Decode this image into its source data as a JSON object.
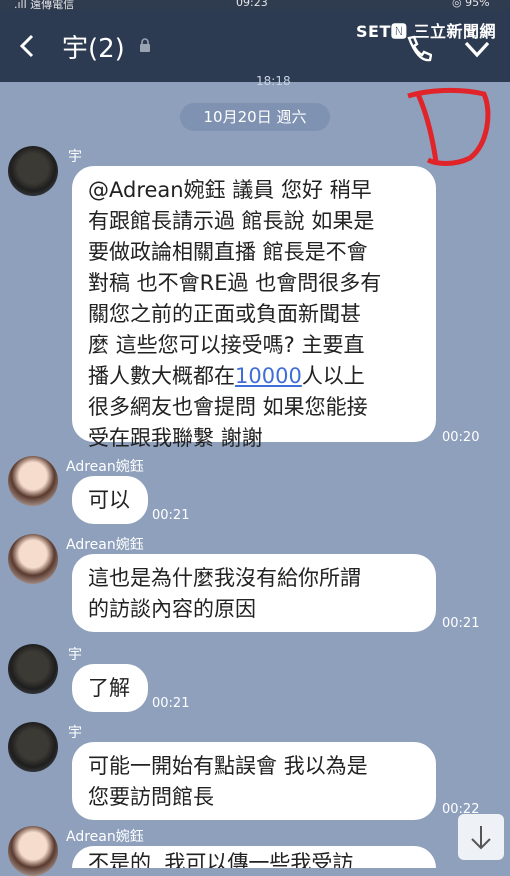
{
  "status": {
    "carrier": ".ıll 遠傳電信",
    "time": "09:23",
    "battery": "◎ 95%"
  },
  "header": {
    "title": "宇(2)",
    "watermark": "SET🅽 三立新聞網"
  },
  "prev_time": "18:18",
  "date_separator": "10月20日 週六",
  "messages": [
    {
      "sender": "宇",
      "pre": "@Adrean婉鈺 議員 您好 稍早\n有跟館長請示過 館長說 如果是\n要做政論相關直播 館長是不會\n對稿 也不會RE過 也會問很多有\n關您之前的正面或負面新聞甚\n麼 這些您可以接受嗎? 主要直\n播人數大概都在",
      "link": "10000",
      "post": "人以上\n很多網友也會提問 如果您能接\n受在跟我聯繫 謝謝",
      "time": "00:20"
    },
    {
      "sender": "Adrean婉鈺",
      "text": "可以",
      "time": "00:21"
    },
    {
      "sender": "Adrean婉鈺",
      "text": "這也是為什麼我沒有給你所謂\n的訪談內容的原因",
      "time": "00:21"
    },
    {
      "sender": "宇",
      "text": "了解",
      "time": "00:21"
    },
    {
      "sender": "宇",
      "text": "可能一開始有點誤會 我以為是\n您要訪問館長",
      "time": "00:22"
    },
    {
      "sender": "Adrean婉鈺",
      "text": "不是的  我可以傳一些我受訪",
      "time": ""
    }
  ],
  "icons": {
    "back": "chevron-left-icon",
    "lock": "lock-icon",
    "phone": "phone-icon",
    "menu": "chevron-down-icon",
    "scroll": "arrow-down-icon"
  },
  "colors": {
    "background": "#8fa0bd",
    "header": "#2c3a52",
    "bubble": "#ffffff",
    "link": "#3f6fd6",
    "annotation": "#e0242a"
  }
}
